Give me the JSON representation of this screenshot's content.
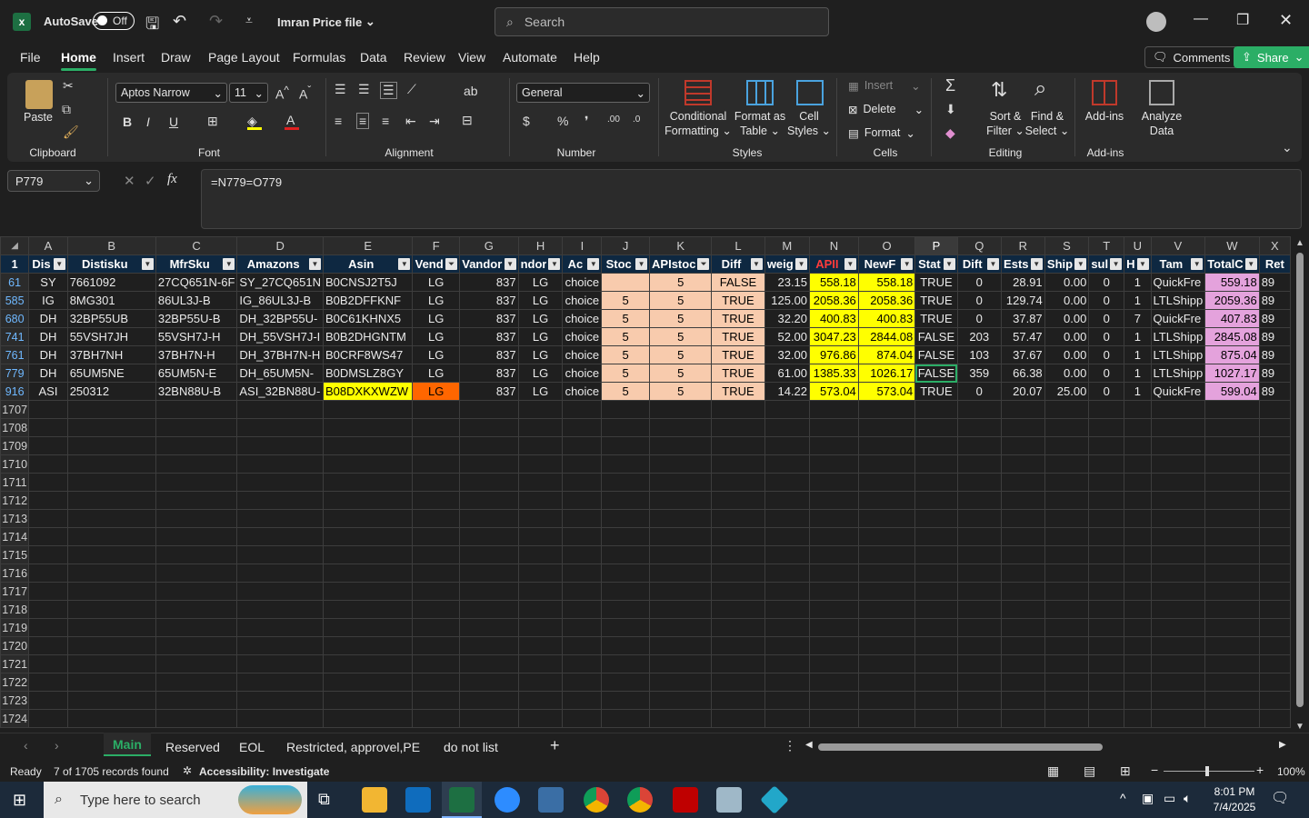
{
  "titlebar": {
    "autosave_label": "AutoSave",
    "autosave_state": "Off",
    "file_name": "Imran Price file",
    "search_placeholder": "Search"
  },
  "menu": [
    "File",
    "Home",
    "Insert",
    "Draw",
    "Page Layout",
    "Formulas",
    "Data",
    "Review",
    "View",
    "Automate",
    "Help"
  ],
  "header_buttons": {
    "comments": "Comments",
    "share": "Share"
  },
  "ribbon": {
    "paste": "Paste",
    "font_name": "Aptos Narrow",
    "font_size": "11",
    "number_format": "General",
    "conditional_formatting": [
      "Conditional",
      "Formatting"
    ],
    "format_as_table": [
      "Format as",
      "Table"
    ],
    "cell_styles": [
      "Cell",
      "Styles"
    ],
    "insert": "Insert",
    "delete": "Delete",
    "format": "Format",
    "sort_filter": [
      "Sort &",
      "Filter"
    ],
    "find_select": [
      "Find &",
      "Select"
    ],
    "add_ins": "Add-ins",
    "analyze_data": [
      "Analyze",
      "Data"
    ],
    "groups": [
      "Clipboard",
      "Font",
      "Alignment",
      "Number",
      "Styles",
      "Cells",
      "Editing",
      "Add-ins"
    ]
  },
  "formula_bar": {
    "name_box": "P779",
    "formula": "=N779=O779"
  },
  "grid": {
    "column_letters": [
      "A",
      "B",
      "C",
      "D",
      "E",
      "F",
      "G",
      "H",
      "I",
      "J",
      "K",
      "L",
      "M",
      "N",
      "O",
      "P",
      "Q",
      "R",
      "S",
      "T",
      "U",
      "V",
      "W",
      "X"
    ],
    "header_row_number": "1",
    "headers": [
      "Dis",
      "Distisku",
      "MfrSku",
      "Amazons",
      "Asin",
      "Vend",
      "Vandor",
      "ndor",
      "Ac",
      "Stoc",
      "APIstoc",
      "Diff",
      "weig",
      "APII",
      "NewF",
      "Stat",
      "Dift",
      "Ests",
      "Ship",
      "sul",
      "H",
      "Tam",
      "TotalC",
      "Ret"
    ],
    "rows": [
      {
        "n": "61",
        "cells": [
          "SY",
          "7661092",
          "27CQ651N-6F",
          "SY_27CQ651N",
          "B0CNSJ2T5J",
          "LG",
          "837",
          "LG",
          "choice",
          "",
          "5",
          "FALSE",
          "23.15",
          "558.18",
          "558.18",
          "TRUE",
          "0",
          "28.91",
          "0.00",
          "0",
          "1",
          "QuickFre",
          "559.18",
          "89"
        ]
      },
      {
        "n": "585",
        "cells": [
          "IG",
          "8MG301",
          "86UL3J-B",
          "IG_86UL3J-B",
          "B0B2DFFKNF",
          "LG",
          "837",
          "LG",
          "choice",
          "5",
          "5",
          "TRUE",
          "125.00",
          "2058.36",
          "2058.36",
          "TRUE",
          "0",
          "129.74",
          "0.00",
          "0",
          "1",
          "LTLShipp",
          "2059.36",
          "89"
        ]
      },
      {
        "n": "680",
        "cells": [
          "DH",
          "32BP55UB",
          "32BP55U-B",
          "DH_32BP55U-",
          "B0C61KHNX5",
          "LG",
          "837",
          "LG",
          "choice",
          "5",
          "5",
          "TRUE",
          "32.20",
          "400.83",
          "400.83",
          "TRUE",
          "0",
          "37.87",
          "0.00",
          "0",
          "7",
          "QuickFre",
          "407.83",
          "89"
        ]
      },
      {
        "n": "741",
        "cells": [
          "DH",
          "55VSH7JH",
          "55VSH7J-H",
          "DH_55VSH7J-I",
          "B0B2DHGNTM",
          "LG",
          "837",
          "LG",
          "choice",
          "5",
          "5",
          "TRUE",
          "52.00",
          "3047.23",
          "2844.08",
          "FALSE",
          "203",
          "57.47",
          "0.00",
          "0",
          "1",
          "LTLShipp",
          "2845.08",
          "89"
        ]
      },
      {
        "n": "761",
        "cells": [
          "DH",
          "37BH7NH",
          "37BH7N-H",
          "DH_37BH7N-H",
          "B0CRF8WS47",
          "LG",
          "837",
          "LG",
          "choice",
          "5",
          "5",
          "TRUE",
          "32.00",
          "976.86",
          "874.04",
          "FALSE",
          "103",
          "37.67",
          "0.00",
          "0",
          "1",
          "LTLShipp",
          "875.04",
          "89"
        ]
      },
      {
        "n": "779",
        "cells": [
          "DH",
          "65UM5NE",
          "65UM5N-E",
          "DH_65UM5N-",
          "B0DMSLZ8GY",
          "LG",
          "837",
          "LG",
          "choice",
          "5",
          "5",
          "TRUE",
          "61.00",
          "1385.33",
          "1026.17",
          "FALSE",
          "359",
          "66.38",
          "0.00",
          "0",
          "1",
          "LTLShipp",
          "1027.17",
          "89"
        ]
      },
      {
        "n": "916",
        "cells": [
          "ASI",
          "250312",
          "32BN88U-B",
          "ASI_32BN88U-",
          "B08DXKXWZW",
          "LG",
          "837",
          "LG",
          "choice",
          "5",
          "5",
          "TRUE",
          "14.22",
          "573.04",
          "573.04",
          "TRUE",
          "0",
          "20.07",
          "25.00",
          "0",
          "1",
          "QuickFre",
          "599.04",
          "89"
        ]
      }
    ],
    "empty_rows": [
      "1707",
      "1708",
      "1709",
      "1710",
      "1711",
      "1712",
      "1713",
      "1714",
      "1715",
      "1716",
      "1717",
      "1718",
      "1719",
      "1720",
      "1721",
      "1722",
      "1723",
      "1724"
    ]
  },
  "sheets": [
    "Main",
    "Reserved",
    "EOL",
    "Restricted, approvel,PE",
    "do not list"
  ],
  "status": {
    "ready": "Ready",
    "records": "7 of 1705 records found",
    "accessibility": "Accessibility: Investigate",
    "zoom": "100%"
  },
  "taskbar": {
    "search_placeholder": "Type here to search",
    "time": "8:01 PM",
    "date": "7/4/2025"
  }
}
